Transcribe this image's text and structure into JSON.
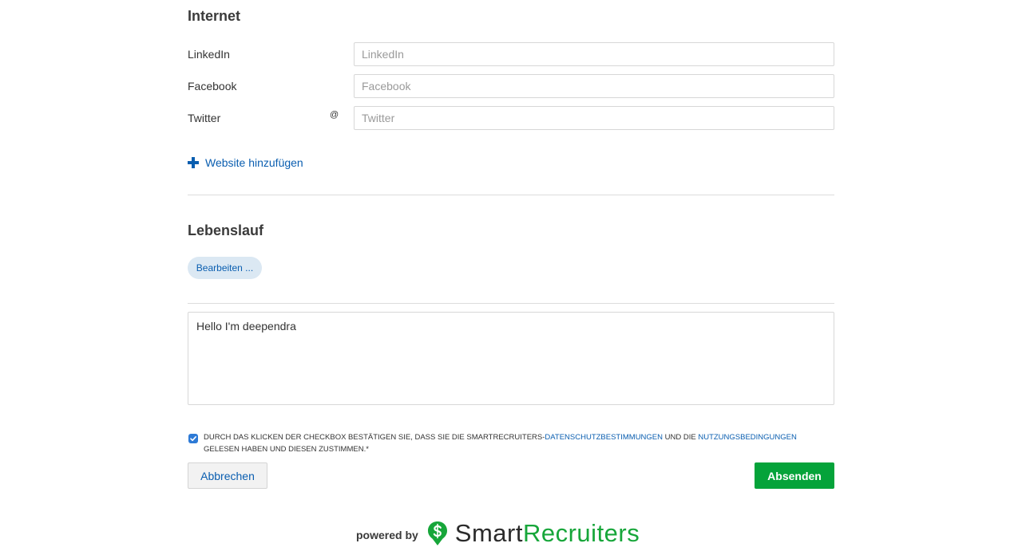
{
  "internet": {
    "heading": "Internet",
    "fields": [
      {
        "label": "LinkedIn",
        "prefix": "",
        "placeholder": "LinkedIn",
        "value": ""
      },
      {
        "label": "Facebook",
        "prefix": "",
        "placeholder": "Facebook",
        "value": ""
      },
      {
        "label": "Twitter",
        "prefix": "@",
        "placeholder": "Twitter",
        "value": ""
      }
    ],
    "add_website_label": "Website hinzufügen"
  },
  "resume": {
    "heading": "Lebenslauf",
    "edit_button_label": "Bearbeiten ..."
  },
  "message": {
    "value": "Hello I'm deependra"
  },
  "consent": {
    "checked": true,
    "text_before": "Durch das Klicken der Checkbox bestätigen Sie, dass Sie die SmartRecruiters-",
    "privacy_link": "Datenschutzbestimmungen",
    "text_middle": " und die ",
    "terms_link": "Nutzungsbedingungen",
    "text_after": " gelesen haben und diesen zustimmen.*"
  },
  "actions": {
    "cancel_label": "Abbrechen",
    "submit_label": "Absenden"
  },
  "footer": {
    "powered_by": "powered by",
    "brand_part1": "Smart",
    "brand_part2": "Recruiters",
    "brand_color": "#17a63a"
  },
  "colors": {
    "link": "#0a5eb0",
    "submit": "#05a33a",
    "checkbox": "#2d7ad6"
  }
}
